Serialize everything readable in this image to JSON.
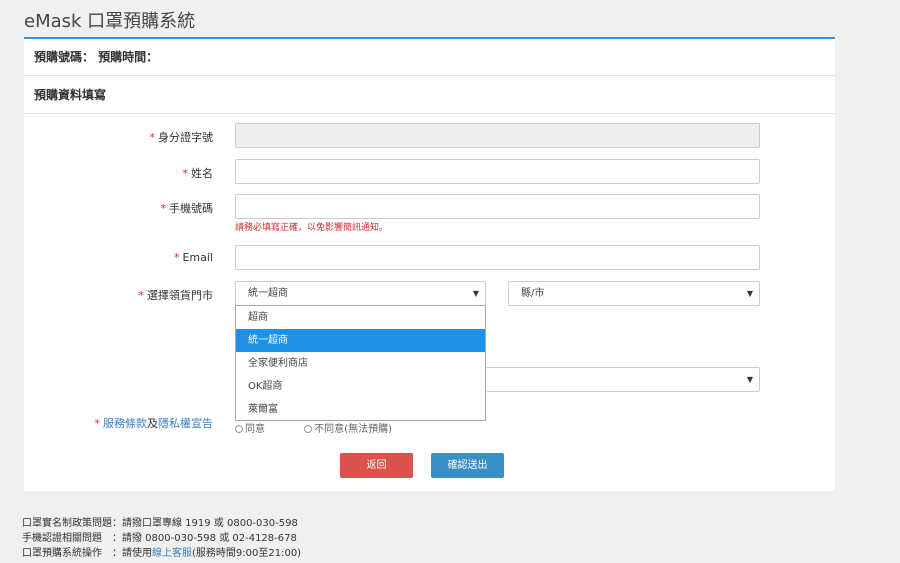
{
  "app": {
    "title": "eMask 口罩預購系統"
  },
  "header": {
    "order_info": "預購號碼： 預購時間：",
    "section_title": "預購資料填寫"
  },
  "form": {
    "required_mark": "*",
    "id_label": "身分證字號",
    "name_label": "姓名",
    "phone_label": "手機號碼",
    "phone_hint": "請務必填寫正確，以免影響簡訊通知。",
    "email_label": "Email",
    "store_label": "選擇領貨門市",
    "store_selected": "統一超商",
    "county_selected": "縣/市",
    "terms_label_a": "服務條款",
    "terms_label_and": "及",
    "terms_label_b": "隱私權宣告",
    "agree": "同意",
    "disagree": "不同意(無法預購)"
  },
  "dropdown": {
    "options": [
      "超商",
      "統一超商",
      "全家便利商店",
      "OK超商",
      "萊爾富"
    ],
    "active_index": 1
  },
  "buttons": {
    "back": "返回",
    "submit": "確認送出"
  },
  "footer": {
    "line1": "口罩實名制政策問題：請撥口罩專線 1919 或 0800-030-598",
    "line2": "手機認證相關問題　：請撥 0800-030-598 或 02-4128-678",
    "line3_prefix": "口罩預購系統操作　：請使用",
    "line3_link": "線上客服",
    "line3_suffix": "(服務時間9:00至21:00)"
  },
  "colors": {
    "accent": "#3a8fd6",
    "required": "#c9302c",
    "back_button": "#d9534f",
    "submit_button": "#3a8fc7",
    "dropdown_active": "#1e90e6"
  }
}
